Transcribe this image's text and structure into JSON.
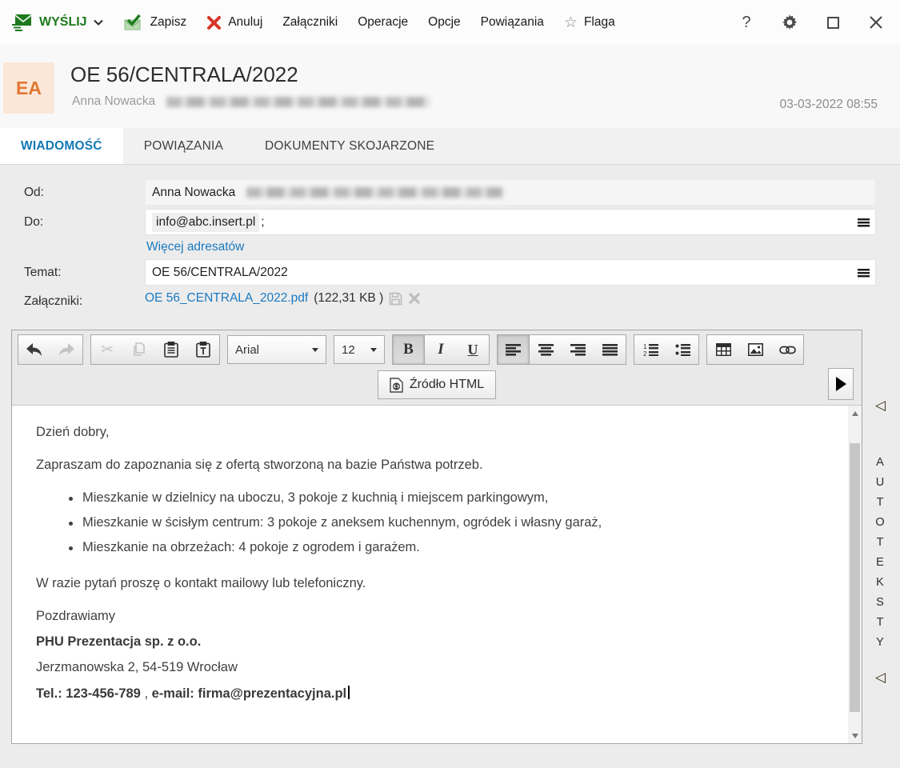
{
  "titlebar": {
    "send_label": "WYŚLIJ",
    "save_label": "Zapisz",
    "cancel_label": "Anuluj",
    "attachments_label": "Załączniki",
    "operations_label": "Operacje",
    "options_label": "Opcje",
    "relations_label": "Powiązania",
    "flag_label": "Flaga",
    "help_label": "?"
  },
  "header": {
    "avatar_initials": "EA",
    "subject": "OE 56/CENTRALA/2022",
    "sender_name": "Anna Nowacka",
    "datetime": "03-03-2022 08:55"
  },
  "tabs": [
    {
      "label": "WIADOMOŚĆ"
    },
    {
      "label": "POWIĄZANIA"
    },
    {
      "label": "DOKUMENTY SKOJARZONE"
    }
  ],
  "form": {
    "from": {
      "label": "Od:",
      "value": "Anna Nowacka"
    },
    "to": {
      "label": "Do:",
      "value": "info@abc.insert.pl",
      "separator": ";"
    },
    "more_recipients_link": "Więcej adresatów",
    "subject": {
      "label": "Temat:",
      "value": "OE 56/CENTRALA/2022"
    },
    "attachments": {
      "label": "Załączniki:",
      "file_name": "OE 56_CENTRALA_2022.pdf",
      "file_size": "(122,31 KB )"
    }
  },
  "editor_toolbar": {
    "font_family_value": "Arial",
    "font_size_value": "12",
    "bold_label": "B",
    "italic_label": "I",
    "underline_label": "U",
    "source_button_label": "Źródło HTML"
  },
  "email_body": {
    "greeting": "Dzień dobry,",
    "intro": "Zapraszam do zapoznania się z ofertą stworzoną na bazie Państwa potrzeb.",
    "bullets": [
      "Mieszkanie w dzielnicy na uboczu, 3 pokoje z kuchnią i miejscem parkingowym,",
      "Mieszkanie w ścisłym centrum: 3 pokoje z aneksem kuchennym, ogródek i własny garaż,",
      "Mieszkanie na obrzeżach: 4 pokoje z ogrodem i garażem."
    ],
    "closing": "W razie pytań proszę o kontakt mailowy lub telefoniczny.",
    "signoff": "Pozdrawiamy",
    "company": "PHU Prezentacja sp. z o.o.",
    "address": "Jerzmanowska 2, 54-519 Wrocław",
    "phone": "Tel.: 123-456-789",
    "separator": " , ",
    "email_contact": "e-mail: firma@prezentacyjna.pl"
  },
  "side_panel": {
    "label": "AUTOTEKSTY"
  },
  "colors": {
    "accent_green": "#1d7a1d",
    "accent_red": "#d8352a",
    "link_blue": "#1b7ac1",
    "tab_active_blue": "#1279b5"
  }
}
